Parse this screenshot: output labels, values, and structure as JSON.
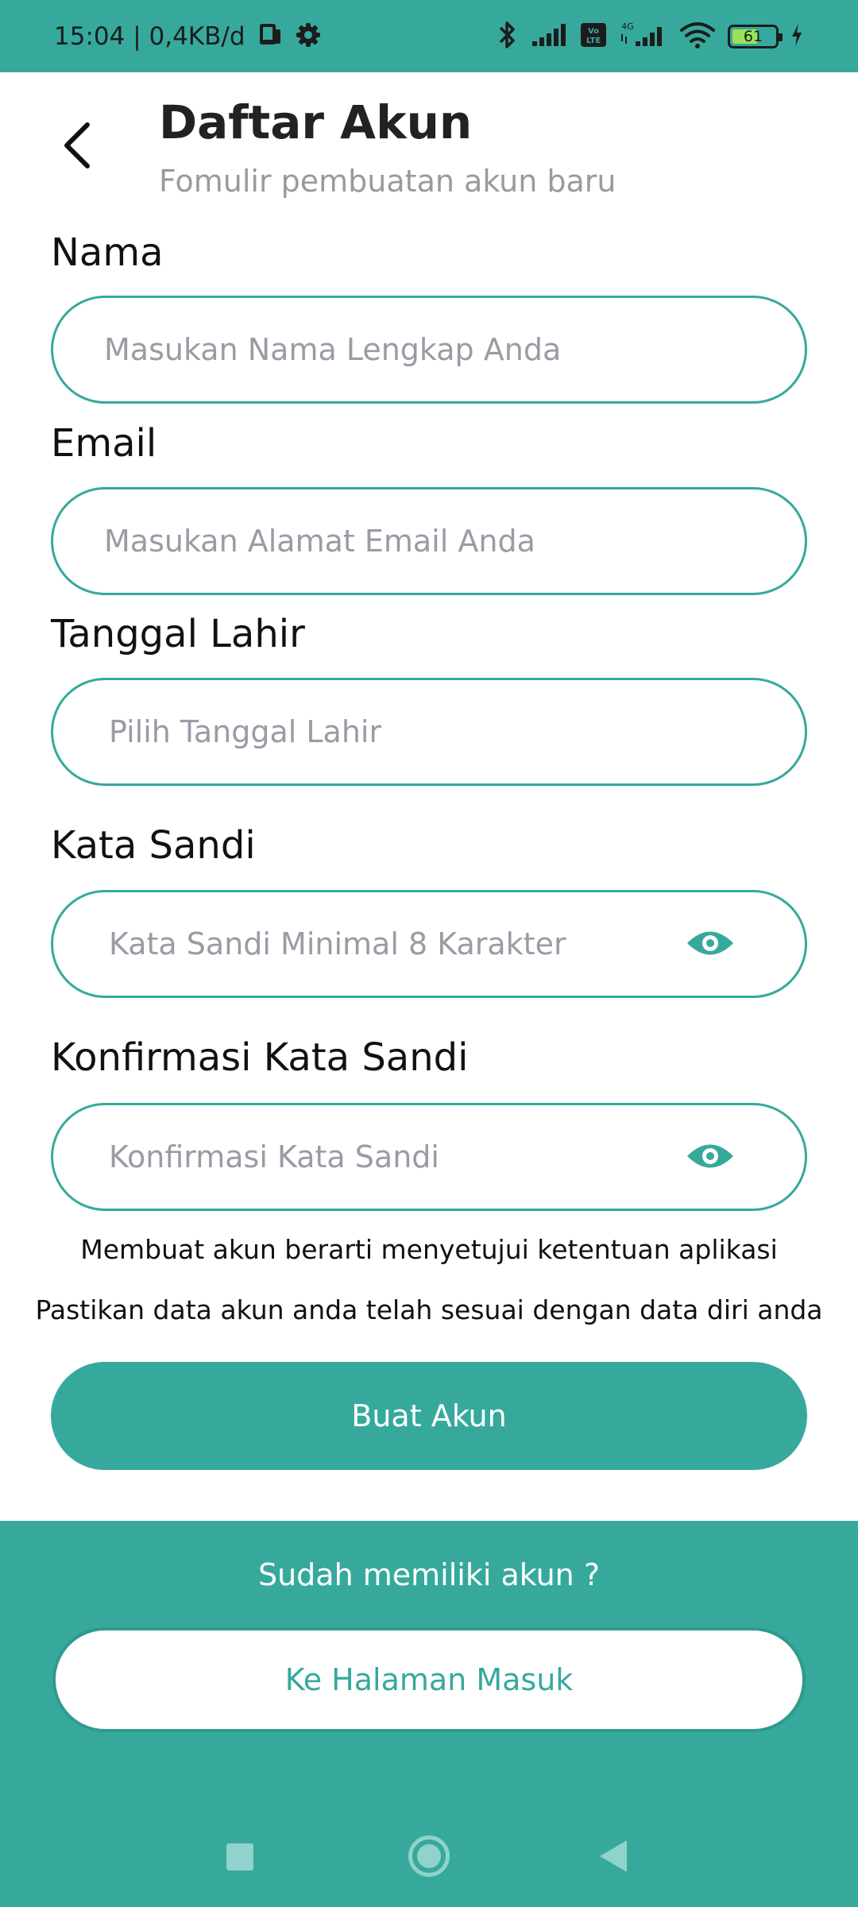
{
  "status_bar": {
    "time_speed": "15:04 | 0,4KB/d",
    "battery_level": "61",
    "icons": [
      "phone-icon",
      "settings-gear-icon",
      "bluetooth-icon",
      "signal-icon",
      "volte-icon",
      "4g-signal-icon",
      "wifi-icon",
      "battery-icon",
      "charging-icon"
    ],
    "lte_badge": "Vo LTE",
    "network_badge": "4G"
  },
  "header": {
    "title": "Daftar Akun",
    "subtitle": "Fomulir pembuatan akun baru"
  },
  "form": {
    "nama": {
      "label": "Nama",
      "placeholder": "Masukan Nama Lengkap Anda"
    },
    "email": {
      "label": "Email",
      "placeholder": "Masukan Alamat Email Anda"
    },
    "tanggal_lahir": {
      "label": "Tanggal Lahir",
      "placeholder": "Pilih Tanggal Lahir"
    },
    "kata_sandi": {
      "label": "Kata Sandi",
      "placeholder": "Kata Sandi Minimal 8 Karakter"
    },
    "konfirmasi": {
      "label": "Konfirmasi Kata Sandi",
      "placeholder": "Konfirmasi Kata Sandi"
    }
  },
  "notes": {
    "agreement": "Membuat akun berarti menyetujui ketentuan aplikasi",
    "verify": "Pastikan data akun anda telah sesuai dengan data diri anda"
  },
  "actions": {
    "create_account": "Buat Akun"
  },
  "footer": {
    "question": "Sudah memiliki akun ?",
    "login_button": "Ke Halaman Masuk"
  },
  "colors": {
    "accent": "#36a99c",
    "placeholder": "#9a9ba5",
    "subtitle": "#9a9a9a"
  }
}
